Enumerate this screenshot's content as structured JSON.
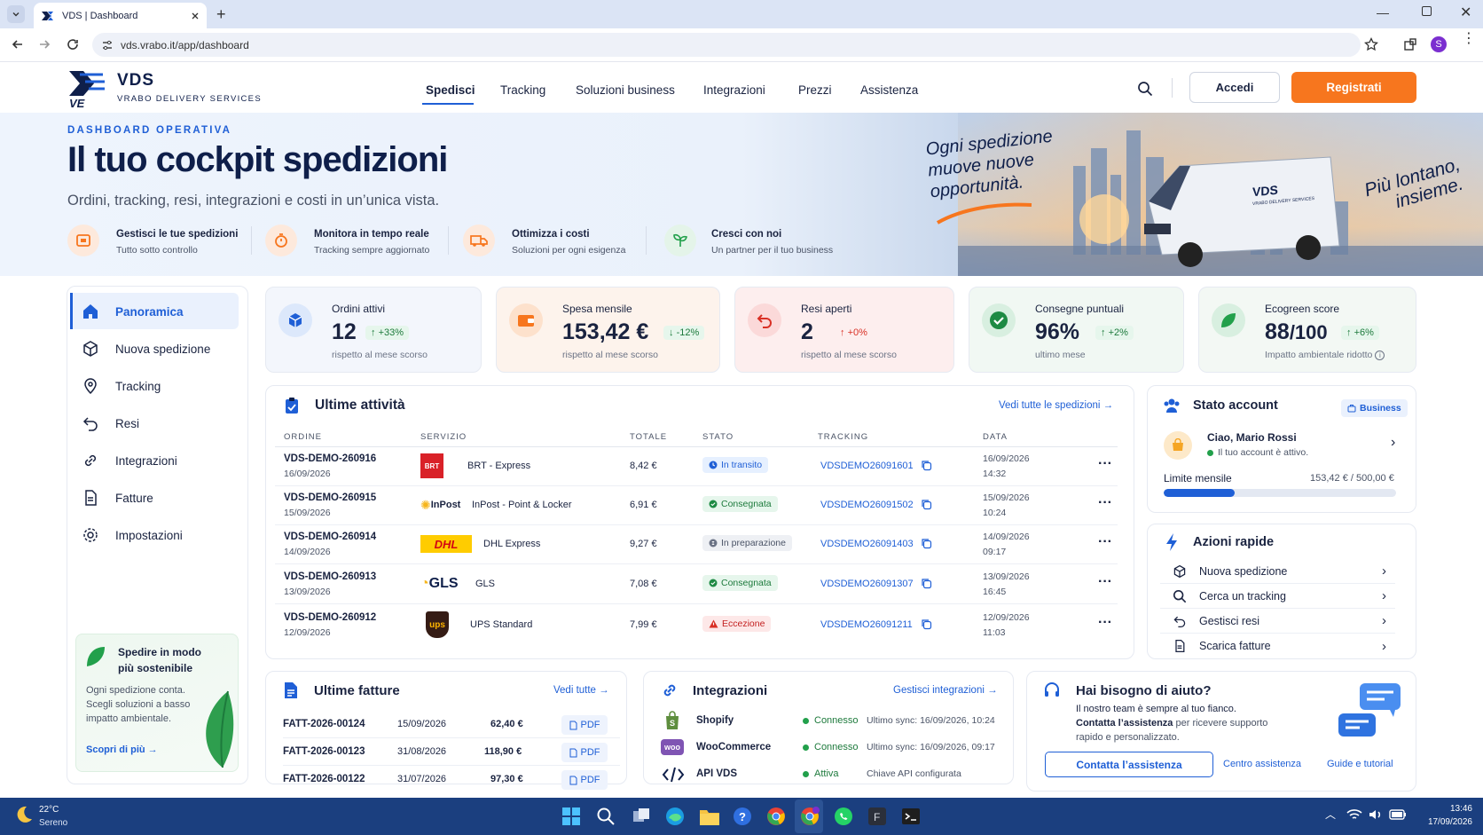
{
  "browser": {
    "tab_title": "VDS | Dashboard",
    "url": "vds.vrabo.it/app/dashboard",
    "profile_initial": "S"
  },
  "header": {
    "brand": "VDS",
    "brand_sub": "VRABO DELIVERY SERVICES",
    "logo_letters": "VE",
    "nav": [
      "Spedisci",
      "Tracking",
      "Soluzioni business",
      "Integrazioni",
      "Prezzi",
      "Assistenza"
    ],
    "login": "Accedi",
    "register": "Registrati"
  },
  "hero": {
    "kicker": "DASHBOARD OPERATIVA",
    "title": "Il tuo cockpit spedizioni",
    "subtitle": "Ordini, tracking, resi, integrazioni e costi in un’unica vista.",
    "features": [
      {
        "title": "Gestisci le tue spedizioni",
        "sub": "Tutto sotto controllo"
      },
      {
        "title": "Monitora in tempo reale",
        "sub": "Tracking sempre aggiornato"
      },
      {
        "title": "Ottimizza i costi",
        "sub": "Soluzioni per ogni esigenza"
      },
      {
        "title": "Cresci con noi",
        "sub": "Un partner per il tuo business"
      }
    ],
    "slogan_1": "Ogni spedizione",
    "slogan_2": "muove nuove",
    "slogan_3": "opportunità.",
    "tagline_1": "Più lontano,",
    "tagline_2": "insieme.",
    "van_brand": "VDS",
    "van_sub": "VRABO DELIVERY SERVICES"
  },
  "sidebar": {
    "items": [
      "Panoramica",
      "Nuova spedizione",
      "Tracking",
      "Resi",
      "Integrazioni",
      "Fatture",
      "Impostazioni"
    ],
    "eco_title_1": "Spedire in modo",
    "eco_title_2": "più sostenibile",
    "eco_text_1": "Ogni spedizione conta.",
    "eco_text_2": "Scegli soluzioni a basso",
    "eco_text_3": "impatto ambientale.",
    "eco_link": "Scopri di più"
  },
  "kpis": [
    {
      "label": "Ordini attivi",
      "value": "12",
      "change": "+33%",
      "sub": "rispetto al mese scorso"
    },
    {
      "label": "Spesa mensile",
      "value": "153,42 €",
      "change": "-12%",
      "sub": "rispetto al mese scorso"
    },
    {
      "label": "Resi aperti",
      "value": "2",
      "change": "+0%",
      "sub": "rispetto al mese scorso"
    },
    {
      "label": "Consegne puntuali",
      "value": "96%",
      "change": "+2%",
      "sub": "ultimo mese"
    },
    {
      "label": "Ecogreen score",
      "value": "88",
      "value_suffix": "/100",
      "change": "+6%",
      "sub": "Impatto ambientale ridotto"
    }
  ],
  "activity": {
    "title": "Ultime attività",
    "link": "Vedi tutte le spedizioni",
    "columns": [
      "ORDINE",
      "SERVIZIO",
      "TOTALE",
      "STATO",
      "TRACKING",
      "DATA"
    ],
    "rows": [
      {
        "order": "VDS-DEMO-260916",
        "date": "16/09/2026",
        "carrier": "BRT",
        "service": "BRT - Express",
        "total": "8,42 €",
        "status": "In transito",
        "tracking": "VDSDEMO26091601",
        "d1": "16/09/2026",
        "d2": "14:32"
      },
      {
        "order": "VDS-DEMO-260915",
        "date": "15/09/2026",
        "carrier": "InPost",
        "service": "InPost - Point & Locker",
        "total": "6,91 €",
        "status": "Consegnata",
        "tracking": "VDSDEMO26091502",
        "d1": "15/09/2026",
        "d2": "10:24"
      },
      {
        "order": "VDS-DEMO-260914",
        "date": "14/09/2026",
        "carrier": "DHL",
        "service": "DHL Express",
        "total": "9,27 €",
        "status": "In preparazione",
        "tracking": "VDSDEMO26091403",
        "d1": "14/09/2026",
        "d2": "09:17"
      },
      {
        "order": "VDS-DEMO-260913",
        "date": "13/09/2026",
        "carrier": "GLS",
        "service": "GLS",
        "total": "7,08 €",
        "status": "Consegnata",
        "tracking": "VDSDEMO26091307",
        "d1": "13/09/2026",
        "d2": "16:45"
      },
      {
        "order": "VDS-DEMO-260912",
        "date": "12/09/2026",
        "carrier": "ups",
        "service": "UPS Standard",
        "total": "7,99 €",
        "status": "Eccezione",
        "tracking": "VDSDEMO26091211",
        "d1": "12/09/2026",
        "d2": "11:03"
      }
    ]
  },
  "account": {
    "title": "Stato account",
    "plan": "Business",
    "greeting": "Ciao, Mario Rossi",
    "status": "Il tuo account è attivo.",
    "limit_label": "Limite mensile",
    "limit_value": "153,42 € / 500,00 €",
    "limit_fraction": 0.307
  },
  "quick": {
    "title": "Azioni rapide",
    "items": [
      "Nuova spedizione",
      "Cerca un tracking",
      "Gestisci resi",
      "Scarica fatture"
    ]
  },
  "invoices": {
    "title": "Ultime fatture",
    "link": "Vedi tutte",
    "pdf": "PDF",
    "rows": [
      {
        "id": "FATT-2026-00124",
        "date": "15/09/2026",
        "amount": "62,40 €"
      },
      {
        "id": "FATT-2026-00123",
        "date": "31/08/2026",
        "amount": "118,90 €"
      },
      {
        "id": "FATT-2026-00122",
        "date": "31/07/2026",
        "amount": "97,30 €"
      }
    ]
  },
  "integrations": {
    "title": "Integrazioni",
    "link": "Gestisci integrazioni",
    "rows": [
      {
        "name": "Shopify",
        "status": "Connesso",
        "info": "Ultimo sync: 16/09/2026, 10:24"
      },
      {
        "name": "WooCommerce",
        "status": "Connesso",
        "info": "Ultimo sync: 16/09/2026, 09:17"
      },
      {
        "name": "API VDS",
        "status": "Attiva",
        "info": "Chiave API configurata"
      }
    ]
  },
  "help": {
    "title": "Hai bisogno di aiuto?",
    "line1": "Il nostro team è sempre al tuo fianco.",
    "line2_bold": "Contatta l’assistenza",
    "line2_rest": "per ricevere supporto",
    "line3": "rapido e personalizzato.",
    "button": "Contatta l’assistenza",
    "link1": "Centro assistenza",
    "link2": "Guide e tutorial"
  },
  "taskbar": {
    "temp": "22°C",
    "weather": "Sereno",
    "time": "13:46",
    "date": "17/09/2026"
  },
  "colors": {
    "primary": "#1f5fd6",
    "navy": "#0f1f4a",
    "orange": "#f7761e",
    "green": "#22a04b",
    "red": "#d93025"
  }
}
